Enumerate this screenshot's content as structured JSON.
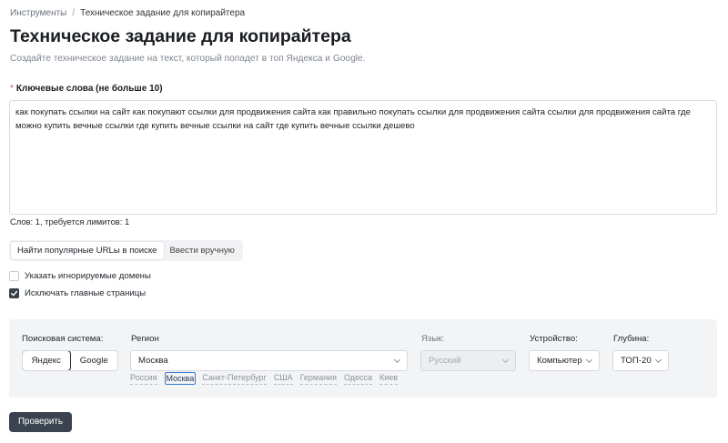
{
  "breadcrumb": {
    "parent": "Инструменты",
    "separator": "/",
    "current": "Техническое задание для копирайтера"
  },
  "page": {
    "title": "Техническое задание для копирайтера",
    "subtitle": "Создайте техническое задание на текст, который попадет в топ Яндекса и Google."
  },
  "keywords": {
    "required_mark": "*",
    "label": "Ключевые слова (не больше 10)",
    "value": "как покупать ссылки на сайт как покупают ссылки для продвижения сайта как правильно покупать ссылки для продвижения сайта ссылки для продвижения сайта где можно купить вечные ссылки где купить вечные ссылки на сайт где купить вечные ссылки дешево",
    "counter": "Слов: 1, требуется лимитов: 1"
  },
  "mode_tabs": [
    {
      "label": "Найти популярные URLы в поиске",
      "active": true
    },
    {
      "label": "Ввести вручную",
      "active": false
    }
  ],
  "checkboxes": [
    {
      "label": "Указать игнорируемые домены",
      "checked": false
    },
    {
      "label": "Исключать главные страницы",
      "checked": true
    }
  ],
  "options": {
    "engine": {
      "label": "Поисковая система:",
      "options": [
        {
          "label": "Яндекс",
          "active": true
        },
        {
          "label": "Google",
          "active": false
        }
      ]
    },
    "region": {
      "label": "Регион",
      "value": "Москва",
      "quick_links": [
        {
          "label": "Россия",
          "active": false
        },
        {
          "label": "Москва",
          "active": true
        },
        {
          "label": "Санкт-Петербург",
          "active": false
        },
        {
          "label": "США",
          "active": false
        },
        {
          "label": "Германия",
          "active": false
        },
        {
          "label": "Одесса",
          "active": false
        },
        {
          "label": "Киев",
          "active": false
        }
      ]
    },
    "language": {
      "label": "Язык:",
      "value": "Русский",
      "disabled": true
    },
    "device": {
      "label": "Устройство:",
      "value": "Компьютер"
    },
    "depth": {
      "label": "Глубина:",
      "value": "ТОП-20"
    }
  },
  "submit_label": "Проверить",
  "colors": {
    "primary_button": "#3b4350",
    "required": "#e5484d",
    "panel_bg": "#f3f4f6",
    "active_link_border": "#3a7bd5"
  }
}
